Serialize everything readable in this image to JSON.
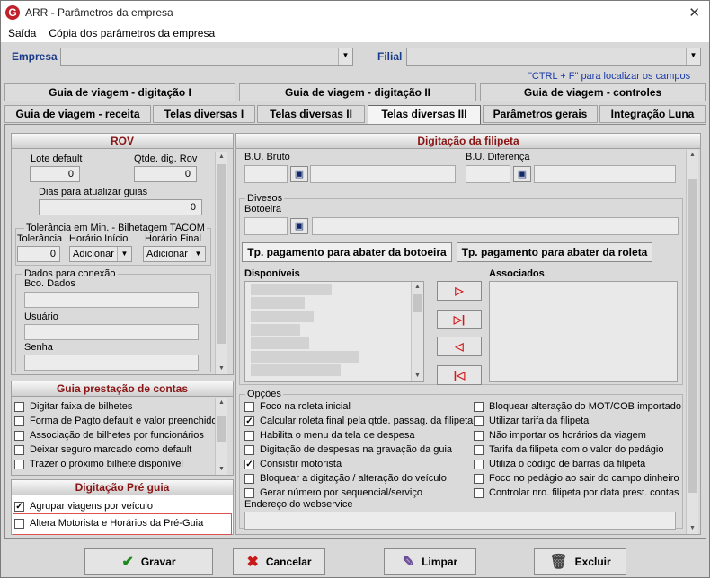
{
  "window": {
    "title": "ARR - Parâmetros da empresa",
    "close": "✕"
  },
  "menu": [
    "Saída",
    "Cópia dos parâmetros da empresa"
  ],
  "header": {
    "empresa_label": "Empresa",
    "filial_label": "Filial",
    "hint": "\"CTRL + F\" para localizar os campos"
  },
  "tabs_row1": [
    "Guia de viagem - digitação I",
    "Guia de viagem - digitação II",
    "Guia de viagem - controles"
  ],
  "tabs_row2": [
    "Guia de viagem - receita",
    "Telas diversas I",
    "Telas diversas II",
    "Telas diversas III",
    "Parâmetros gerais",
    "Integração Luna"
  ],
  "rov": {
    "title": "ROV",
    "lote_label": "Lote default",
    "lote_value": "0",
    "qtde_label": "Qtde. dig. Rov",
    "qtde_value": "0",
    "dias_label": "Dias para atualizar guias",
    "dias_value": "0",
    "tolerancia_group": "Tolerância em Min. - Bilhetagem TACOM",
    "tolerancia_label": "Tolerância",
    "tolerancia_value": "0",
    "inicio_label": "Horário Início",
    "inicio_value": "Adicionar",
    "final_label": "Horário Final",
    "final_value": "Adicionar",
    "conexao_group": "Dados para conexão",
    "bco_label": "Bco. Dados",
    "usuario_label": "Usuário",
    "senha_label": "Senha"
  },
  "prestacao": {
    "title": "Guia prestação de contas",
    "items": [
      {
        "label": "Digitar faixa de bilhetes",
        "checked": false
      },
      {
        "label": "Forma de Pagto default e valor preenchido",
        "checked": false
      },
      {
        "label": "Associação de bilhetes por funcionários",
        "checked": false
      },
      {
        "label": "Deixar seguro marcado como default",
        "checked": false
      },
      {
        "label": "Trazer o próximo bilhete disponível",
        "checked": false
      }
    ]
  },
  "preguia": {
    "title": "Digitação Pré guia",
    "items": [
      {
        "label": "Agrupar viagens por veículo",
        "checked": true
      },
      {
        "label": "Altera Motorista e Horários da Pré-Guia",
        "checked": false
      }
    ]
  },
  "filipeta": {
    "title": "Digitação da filipeta",
    "bu_bruto_label": "B.U. Bruto",
    "bu_diferenca_label": "B.U. Diferença",
    "diversos_group": "Divesos",
    "botoeira_label": "Botoeira",
    "pagto_botoeira_btn": "Tp. pagamento para abater da botoeira",
    "pagto_roleta_btn": "Tp. pagamento para abater da roleta",
    "disponiveis_label": "Disponíveis",
    "associados_label": "Associados",
    "nav": [
      "▷",
      "▷|",
      "◁",
      "|◁"
    ],
    "opcoes_group": "Opções",
    "opcoes_left": [
      {
        "label": "Foco na roleta inicial",
        "checked": false
      },
      {
        "label": "Calcular roleta final pela qtde. passag. da filipeta",
        "checked": true
      },
      {
        "label": "Habilita o menu da tela de despesa",
        "checked": false
      },
      {
        "label": "Digitação de despesas na gravação da guia",
        "checked": false
      },
      {
        "label": "Consistir motorista",
        "checked": true
      },
      {
        "label": "Bloquear a digitação / alteração do veículo",
        "checked": false
      },
      {
        "label": "Gerar número por sequencial/serviço",
        "checked": false
      }
    ],
    "opcoes_right": [
      {
        "label": "Bloquear alteração do MOT/COB importado",
        "checked": false
      },
      {
        "label": "Utilizar tarifa da filipeta",
        "checked": false
      },
      {
        "label": "Não importar os horários da viagem",
        "checked": false
      },
      {
        "label": "Tarifa da filipeta com o valor do pedágio",
        "checked": false
      },
      {
        "label": "Utiliza o código de barras da filipeta",
        "checked": false
      },
      {
        "label": "Foco no pedágio ao sair do campo dinheiro",
        "checked": false
      },
      {
        "label": "Controlar nro. filipeta por data prest. contas",
        "checked": false
      }
    ],
    "webservice_label": "Endereço do webservice"
  },
  "footer": {
    "gravar": "Gravar",
    "cancelar": "Cancelar",
    "limpar": "Limpar",
    "excluir": "Excluir"
  }
}
